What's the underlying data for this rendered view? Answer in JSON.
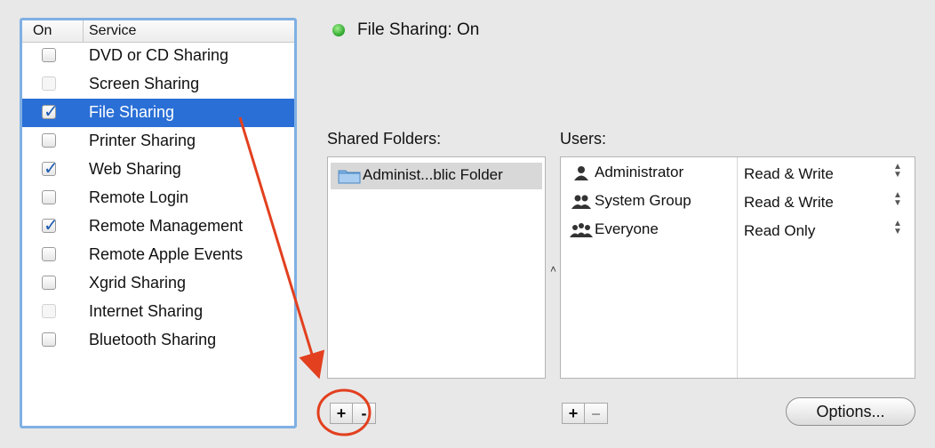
{
  "services": {
    "header_on": "On",
    "header_service": "Service",
    "items": [
      {
        "label": "DVD or CD Sharing",
        "checked": false,
        "enabled": true,
        "selected": false
      },
      {
        "label": "Screen Sharing",
        "checked": false,
        "enabled": false,
        "selected": false
      },
      {
        "label": "File Sharing",
        "checked": true,
        "enabled": true,
        "selected": true
      },
      {
        "label": "Printer Sharing",
        "checked": false,
        "enabled": true,
        "selected": false
      },
      {
        "label": "Web Sharing",
        "checked": true,
        "enabled": true,
        "selected": false
      },
      {
        "label": "Remote Login",
        "checked": false,
        "enabled": true,
        "selected": false
      },
      {
        "label": "Remote Management",
        "checked": true,
        "enabled": true,
        "selected": false
      },
      {
        "label": "Remote Apple Events",
        "checked": false,
        "enabled": true,
        "selected": false
      },
      {
        "label": "Xgrid Sharing",
        "checked": false,
        "enabled": true,
        "selected": false
      },
      {
        "label": "Internet Sharing",
        "checked": false,
        "enabled": false,
        "selected": false
      },
      {
        "label": "Bluetooth Sharing",
        "checked": false,
        "enabled": true,
        "selected": false
      }
    ]
  },
  "status": {
    "text": "File Sharing: On",
    "indicator_color": "#2aa32a"
  },
  "shared_folders": {
    "title": "Shared Folders:",
    "items": [
      {
        "label": "Administ...blic Folder",
        "icon": "folder-icon"
      }
    ],
    "add_label": "+",
    "remove_label": "-"
  },
  "users": {
    "title": "Users:",
    "items": [
      {
        "name": "Administrator",
        "permission": "Read & Write",
        "icon": "single-user-icon"
      },
      {
        "name": "System Group",
        "permission": "Read & Write",
        "icon": "group-icon"
      },
      {
        "name": "Everyone",
        "permission": "Read Only",
        "icon": "everyone-icon"
      }
    ],
    "add_label": "+",
    "remove_label": "–",
    "options_label": "Options..."
  },
  "colors": {
    "selection": "#2a6fd6",
    "list_focus_ring": "#7fb0e3",
    "annotation": "#e2401f"
  }
}
